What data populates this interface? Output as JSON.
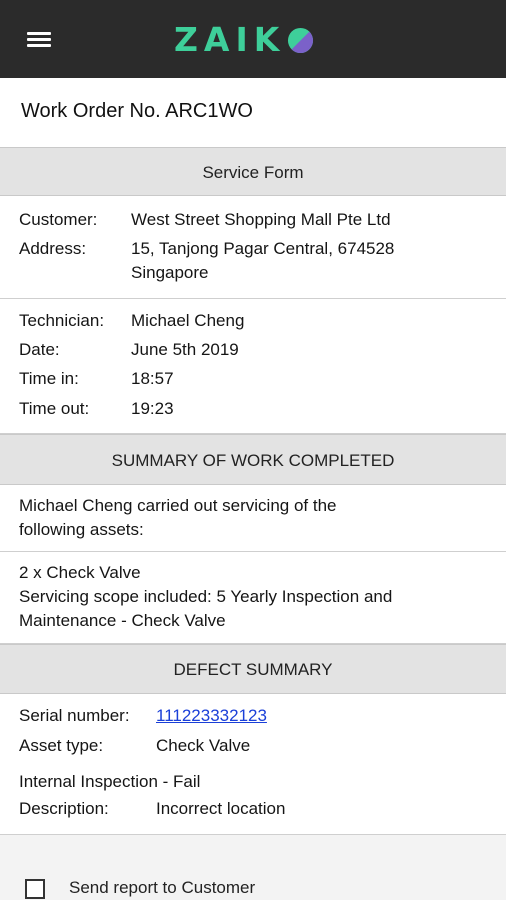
{
  "appbar": {
    "logo_text": "ZAIK",
    "colors": {
      "bar": "#2b2b2b",
      "brand_green": "#3ecf9a",
      "brand_purple": "#7b61c9"
    }
  },
  "page": {
    "title": "Work Order No. ARC1WO"
  },
  "service_form": {
    "header": "Service Form",
    "customer_label": "Customer:",
    "customer": "West Street Shopping Mall Pte Ltd",
    "address_label": "Address:",
    "address_line1": "15, Tanjong Pagar Central, 674528",
    "address_line2": "Singapore",
    "technician_label": "Technician:",
    "technician": "Michael Cheng",
    "date_label": "Date:",
    "date": "June 5th 2019",
    "time_in_label": "Time in:",
    "time_in": "18:57",
    "time_out_label": "Time out:",
    "time_out": "19:23"
  },
  "summary": {
    "header": "SUMMARY OF WORK COMPLETED",
    "intro_line1": "Michael Cheng carried out servicing of the",
    "intro_line2": "following assets:",
    "asset_line1": "2 x Check Valve",
    "asset_line2": "Servicing scope included: 5 Yearly Inspection and",
    "asset_line3": "Maintenance - Check Valve"
  },
  "defect": {
    "header": "DEFECT SUMMARY",
    "serial_label": "Serial number:",
    "serial": "111223332123",
    "asset_type_label": "Asset type:",
    "asset_type": "Check Valve",
    "inspection": "Internal Inspection - Fail",
    "description_label": "Description:",
    "description": "Incorrect location"
  },
  "footer": {
    "send_report_label": "Send report to Customer",
    "send_report_checked": false
  }
}
